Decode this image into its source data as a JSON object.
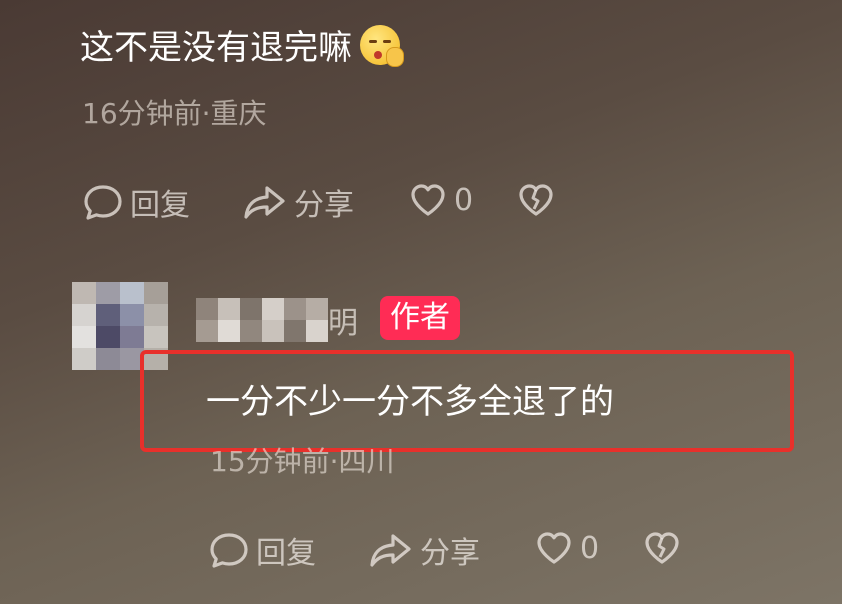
{
  "comment1": {
    "text": "这不是没有退完嘛",
    "meta": "16分钟前·重庆",
    "actions": {
      "reply": "回复",
      "share": "分享",
      "likes": "0"
    }
  },
  "comment2": {
    "name_fragment": "明",
    "badge": "作者",
    "text": "一分不少一分不多全退了的",
    "meta": "15分钟前·四川",
    "actions": {
      "reply": "回复",
      "share": "分享",
      "likes": "0"
    }
  },
  "icons": [
    "reply-icon",
    "share-icon",
    "heart-icon",
    "broken-heart-icon",
    "shush-emoji-icon"
  ],
  "colors": {
    "badge": "#ff2c55",
    "highlight": "#e8302b"
  }
}
